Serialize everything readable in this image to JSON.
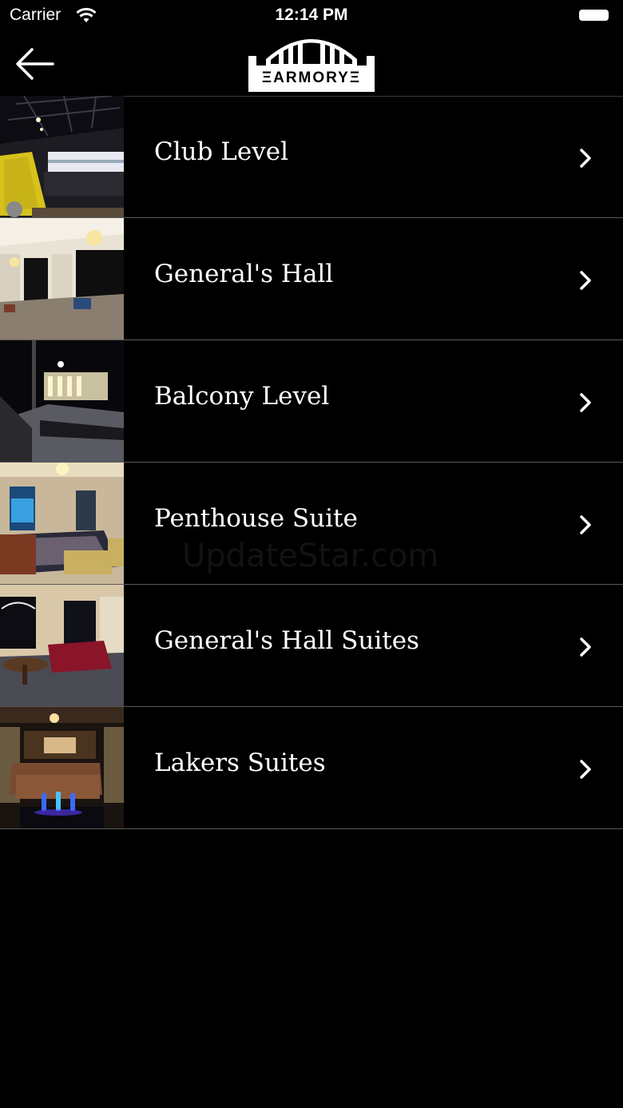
{
  "status_bar": {
    "carrier": "Carrier",
    "time": "12:14 PM"
  },
  "nav": {
    "back_icon": "arrow-left-icon",
    "logo_text": "ΞARMORYΞ"
  },
  "venues": [
    {
      "title": "Club Level",
      "thumb": "club-level-photo"
    },
    {
      "title": "General's Hall",
      "thumb": "generals-hall-photo"
    },
    {
      "title": "Balcony Level",
      "thumb": "balcony-level-photo"
    },
    {
      "title": "Penthouse Suite",
      "thumb": "penthouse-suite-photo"
    },
    {
      "title": "General's Hall Suites",
      "thumb": "generals-hall-suites-photo"
    },
    {
      "title": "Lakers Suites",
      "thumb": "lakers-suites-photo"
    }
  ],
  "watermark": "UpdateStar.com",
  "colors": {
    "background": "#000000",
    "text": "#ffffff",
    "divider": "#5a5a5a"
  }
}
